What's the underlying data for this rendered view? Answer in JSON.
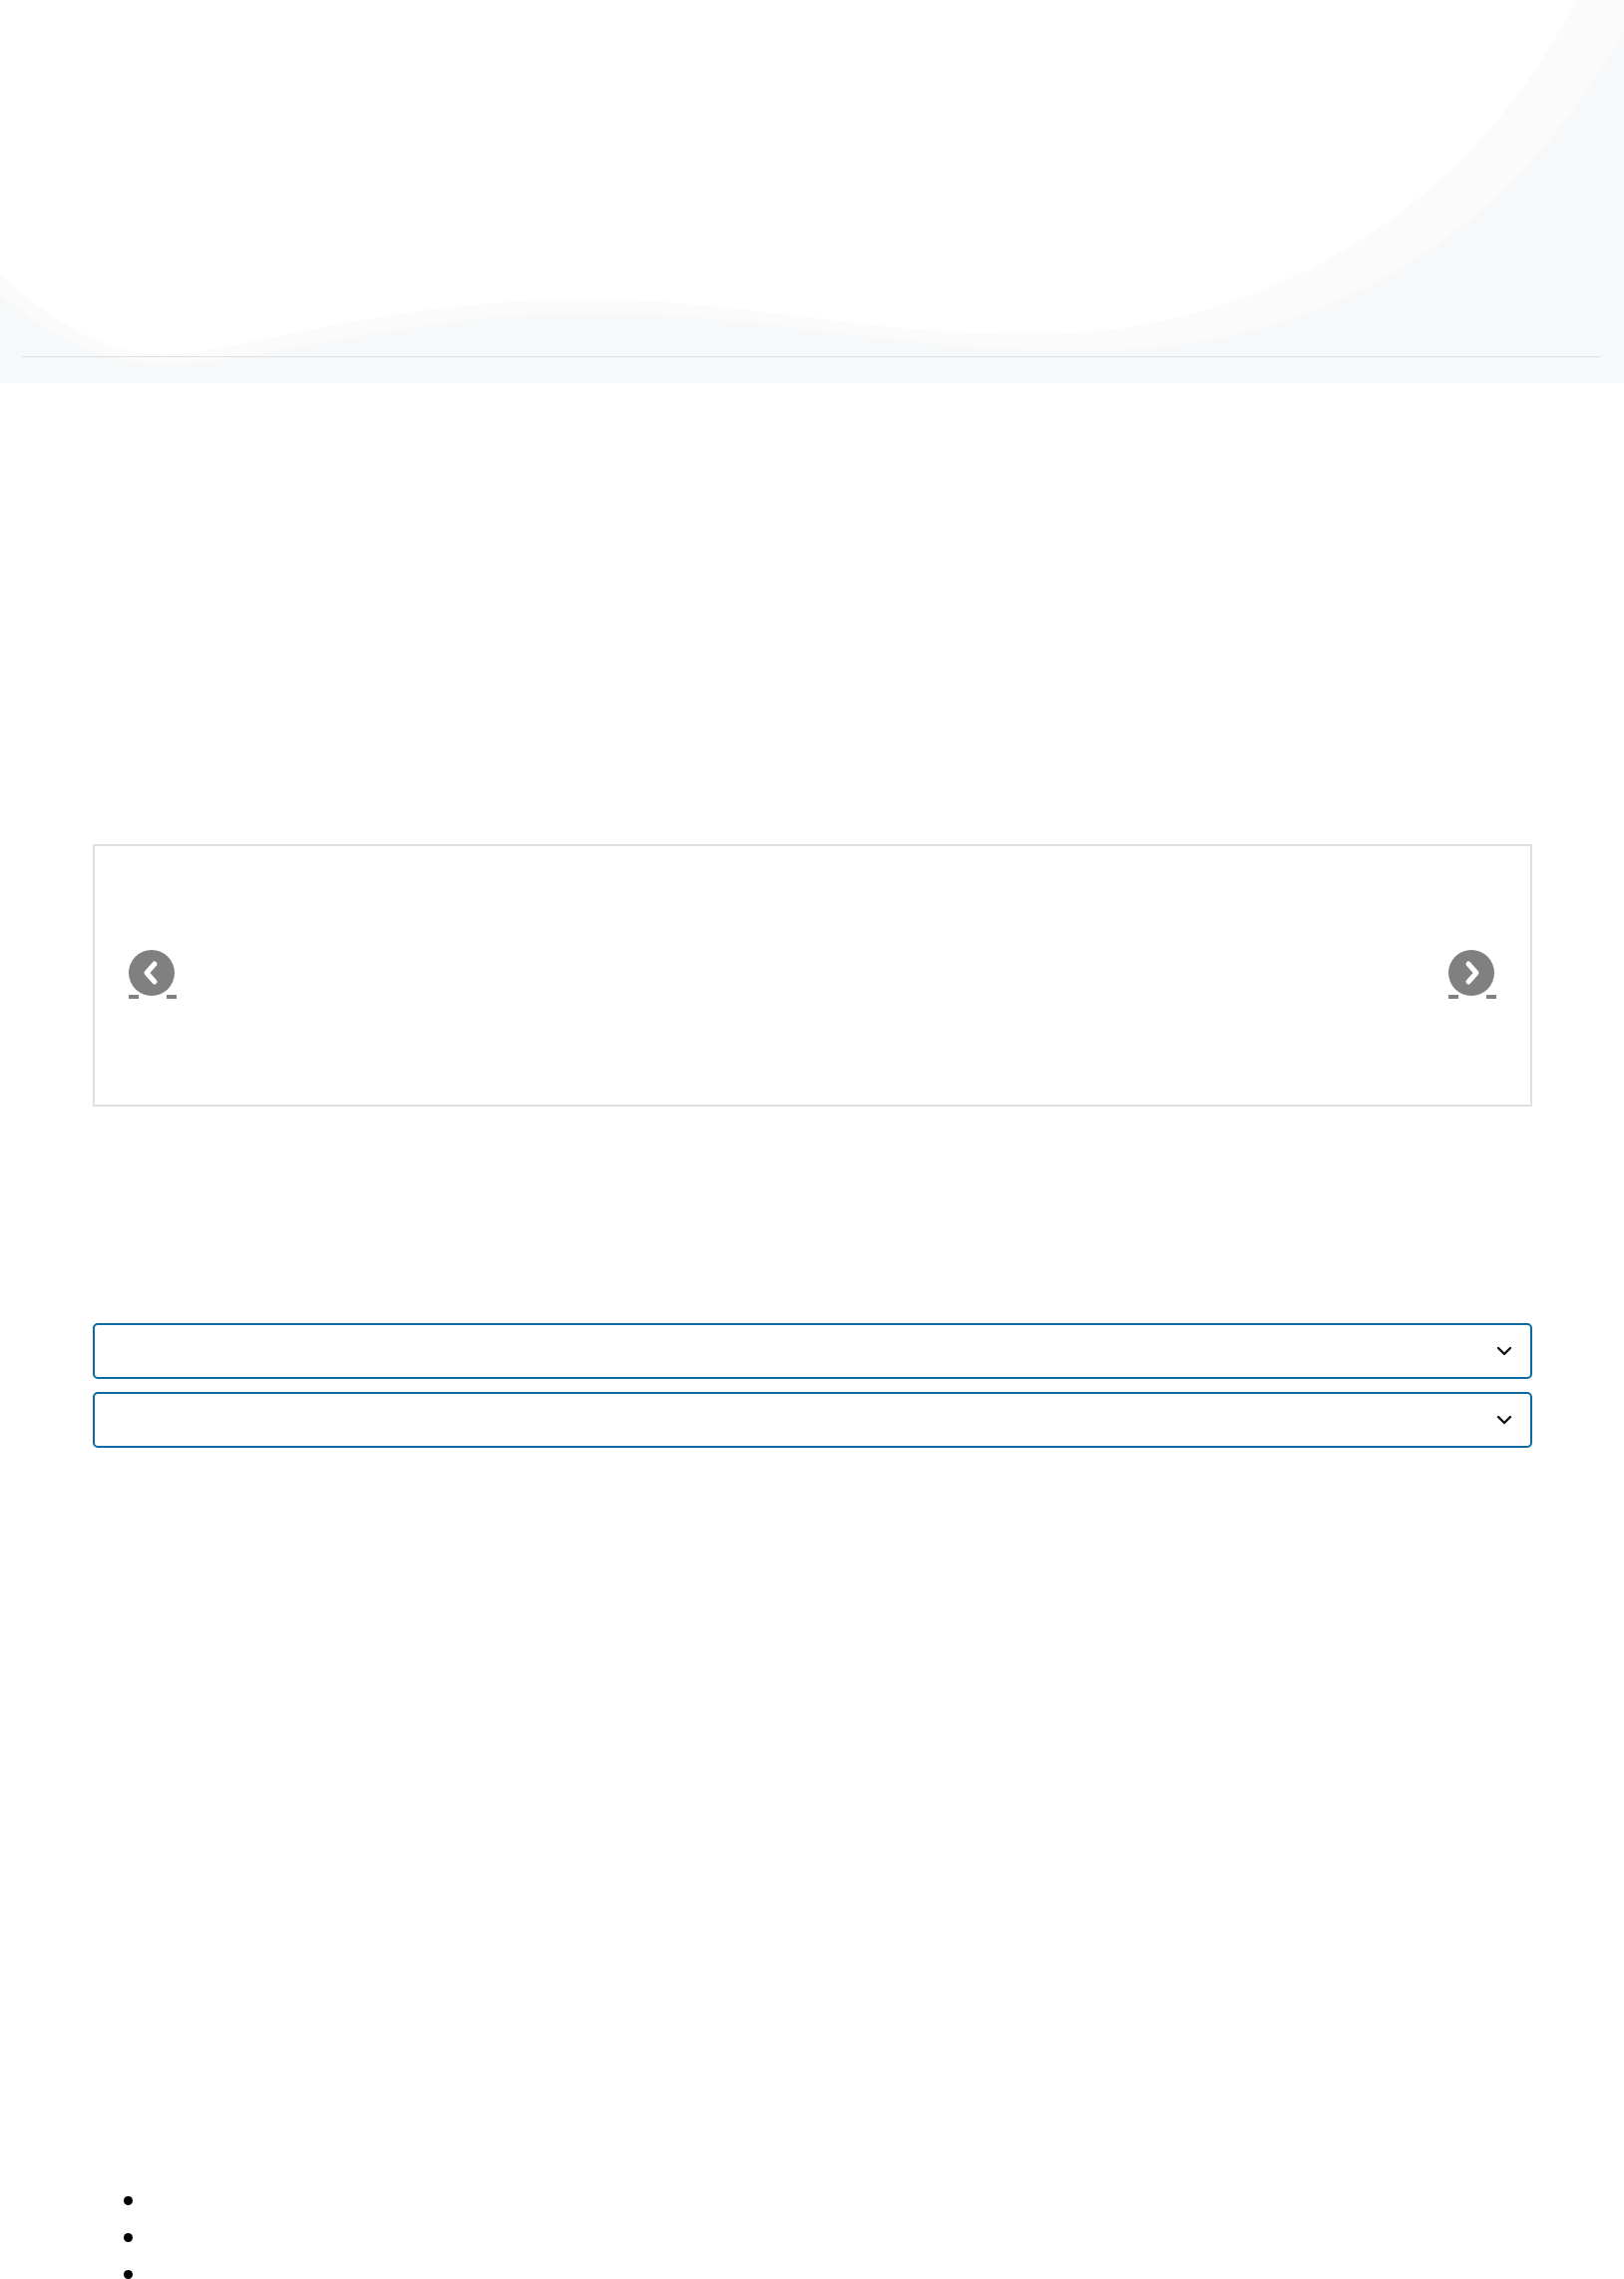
{
  "carousel": {
    "controls": [
      {
        "kind": "previous"
      },
      {
        "kind": "next"
      }
    ]
  },
  "dropdowns": [
    {
      "expanded": false
    },
    {
      "expanded": false
    }
  ],
  "bullet_list": [
    {
      "kind": "bullet"
    },
    {
      "kind": "bullet"
    },
    {
      "kind": "bullet"
    }
  ]
}
